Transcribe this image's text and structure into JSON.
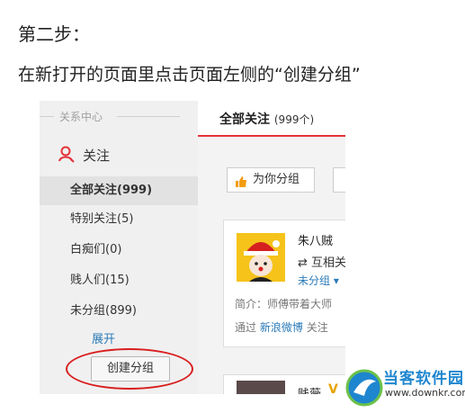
{
  "step_title": "第二步：",
  "instruction": "在新打开的页面里点击页面左侧的“创建分组”",
  "sidebar": {
    "header": "关系中心",
    "follow_label": "关注",
    "items": [
      {
        "label": "全部关注(999)",
        "active": true
      },
      {
        "label": "特别关注(5)",
        "active": false
      },
      {
        "label": "白痴们(0)",
        "active": false
      },
      {
        "label": "贱人们(15)",
        "active": false
      },
      {
        "label": "未分组(899)",
        "active": false
      }
    ],
    "expand": "展开",
    "create_group": "创建分组"
  },
  "main": {
    "tab_title": "全部关注",
    "tab_count": "(999个)",
    "group_button": "为你分组",
    "card": {
      "name": "朱八贼",
      "mutual": "互相关",
      "group": "未分组",
      "intro": "简介：师傅带着大师",
      "via_prefix": "通过",
      "via_link": "新浪微博",
      "via_suffix": "关注"
    },
    "card2": {
      "name": "贱薇",
      "badge": "V"
    }
  },
  "watermark": {
    "name": "当客软件园",
    "url": "www.downkr.com"
  },
  "colors": {
    "accent_red": "#e5333a",
    "link_blue": "#2a7ab8",
    "highlight_circle": "#d91e1e"
  }
}
